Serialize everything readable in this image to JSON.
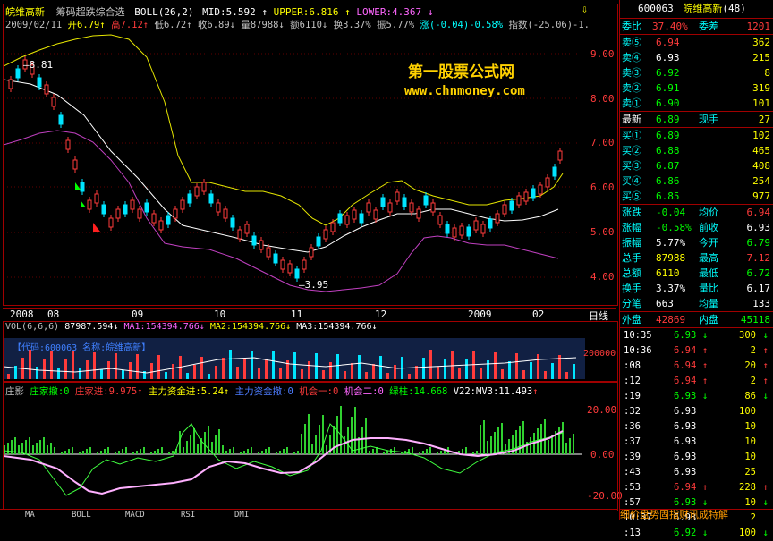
{
  "header": {
    "stock_name": "皖维高新",
    "formula": "筹码超跌综合选",
    "boll_label": "BOLL(26,2)",
    "mid": "MID:5.592",
    "upper": "UPPER:6.816",
    "lower": "LOWER:4.367",
    "date": "2009/02/11",
    "open": "开6.79",
    "high": "高7.12",
    "low": "低6.72",
    "close": "收6.89",
    "volume": "量87988",
    "amount": "额6110",
    "turnover": "换3.37%",
    "amplitude": "振5.77%",
    "change": "涨(-0.04)-0.58%",
    "index": "指数(-25.06)-1."
  },
  "price_axis": [
    "9.00",
    "8.00",
    "7.00",
    "6.00",
    "5.00",
    "4.00"
  ],
  "price_marker": "6.89",
  "annotations": {
    "high_label": "8.81",
    "low_label": "3.95"
  },
  "watermark": {
    "cn": "第一股票公式网",
    "url": "www.chnmoney.com"
  },
  "time_axis": [
    "2008",
    "08",
    "09",
    "10",
    "11",
    "12",
    "2009",
    "02"
  ],
  "time_axis_right": "日线",
  "volume_panel": {
    "vol": "VOL(6,6,6)",
    "vol_val": "87987.594",
    "ma1": "MA1:154394.766",
    "ma2": "MA2:154394.766",
    "ma3": "MA3:154394.766",
    "code_box": "【代码:600063 名称:皖维高新】",
    "axis": "200000"
  },
  "indicator_panel": {
    "name": "庄影",
    "a": "庄家撤:0",
    "b": "庄家进:9.975",
    "c": "主力资金进:5.24",
    "d": "主力资金撤:0",
    "e": "机会一:0",
    "f": "机会二:0",
    "g": "绿柱:14.668",
    "h": "V22:MV3:11.493",
    "axis": [
      "20.00",
      "0.00",
      "-20.00"
    ]
  },
  "tabs": [
    "MA",
    "BOLL",
    "MACD",
    "RSI",
    "DMI"
  ],
  "sidebar": {
    "code": "600063",
    "name": "皖维高新",
    "rank": "(48)",
    "weibi_label": "委比",
    "weibi": "37.40%",
    "weicha_label": "委差",
    "weicha": "1201",
    "sells": [
      {
        "label": "卖⑤",
        "price": "6.94",
        "vol": "362"
      },
      {
        "label": "卖④",
        "price": "6.93",
        "vol": "215"
      },
      {
        "label": "卖③",
        "price": "6.92",
        "vol": "8"
      },
      {
        "label": "卖②",
        "price": "6.91",
        "vol": "319"
      },
      {
        "label": "卖①",
        "price": "6.90",
        "vol": "101"
      }
    ],
    "latest_label": "最新",
    "latest": "6.89",
    "xianshou_label": "现手",
    "xianshou": "27",
    "buys": [
      {
        "label": "买①",
        "price": "6.89",
        "vol": "102"
      },
      {
        "label": "买②",
        "price": "6.88",
        "vol": "465"
      },
      {
        "label": "买③",
        "price": "6.87",
        "vol": "408"
      },
      {
        "label": "买④",
        "price": "6.86",
        "vol": "254"
      },
      {
        "label": "买⑤",
        "price": "6.85",
        "vol": "977"
      }
    ],
    "stats": [
      {
        "l1": "涨跌",
        "v1": "-0.04",
        "l2": "均价",
        "v2": "6.94"
      },
      {
        "l1": "涨幅",
        "v1": "-0.58%",
        "l2": "前收",
        "v2": "6.93"
      },
      {
        "l1": "振幅",
        "v1": "5.77%",
        "l2": "今开",
        "v2": "6.79"
      },
      {
        "l1": "总手",
        "v1": "87988",
        "l2": "最高",
        "v2": "7.12"
      },
      {
        "l1": "总额",
        "v1": "6110",
        "l2": "最低",
        "v2": "6.72"
      },
      {
        "l1": "换手",
        "v1": "3.37%",
        "l2": "量比",
        "v2": "6.17"
      },
      {
        "l1": "分笔",
        "v1": "663",
        "l2": "均量",
        "v2": "133"
      }
    ],
    "outer_label": "外盘",
    "outer": "42869",
    "inner_label": "内盘",
    "inner": "45118",
    "ticks": [
      {
        "t": "10:35",
        "p": "6.93",
        "v": "300",
        "d": "down"
      },
      {
        "t": "10:36",
        "p": "6.94",
        "v": "2",
        "d": "up"
      },
      {
        "t": ":08",
        "p": "6.94",
        "v": "20",
        "d": "up"
      },
      {
        "t": ":12",
        "p": "6.94",
        "v": "2",
        "d": "up"
      },
      {
        "t": ":19",
        "p": "6.93",
        "v": "86",
        "d": "down"
      },
      {
        "t": ":32",
        "p": "6.93",
        "v": "100",
        "d": ""
      },
      {
        "t": ":36",
        "p": "6.93",
        "v": "10",
        "d": ""
      },
      {
        "t": ":37",
        "p": "6.93",
        "v": "10",
        "d": ""
      },
      {
        "t": ":39",
        "p": "6.93",
        "v": "10",
        "d": ""
      },
      {
        "t": ":43",
        "p": "6.93",
        "v": "25",
        "d": ""
      },
      {
        "t": ":53",
        "p": "6.94",
        "v": "228",
        "d": "up"
      },
      {
        "t": ":57",
        "p": "6.93",
        "v": "10",
        "d": "down"
      },
      {
        "t": "10:37",
        "p": "6.93",
        "v": "2",
        "d": ""
      },
      {
        "t": ":13",
        "p": "6.92",
        "v": "100",
        "d": "down"
      }
    ],
    "footer": "细价盘势固指财讯成特解"
  }
}
